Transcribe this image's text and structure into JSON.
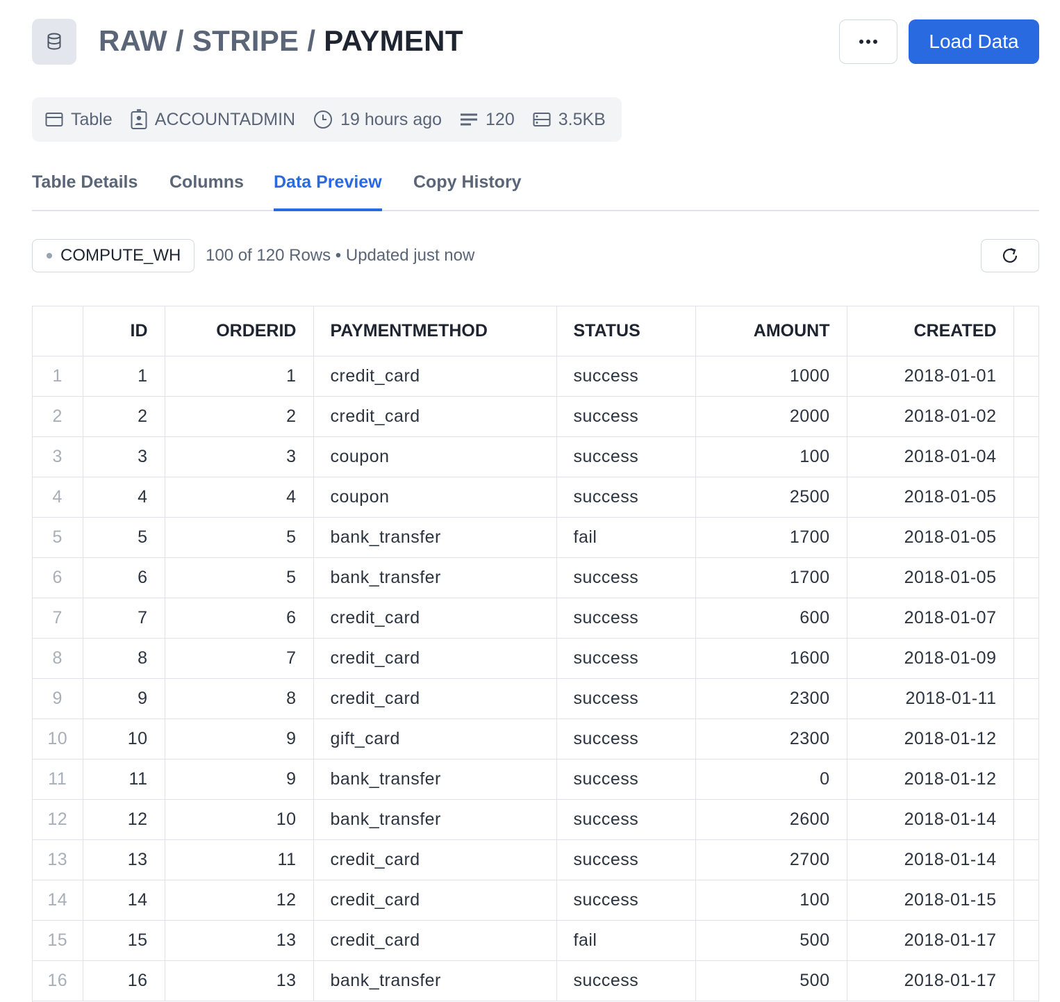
{
  "header": {
    "crumb_1": "RAW",
    "crumb_2": "STRIPE",
    "current": "PAYMENT",
    "separator": "/",
    "load_label": "Load Data"
  },
  "meta": {
    "type": "Table",
    "owner": "ACCOUNTADMIN",
    "updated": "19 hours ago",
    "rows": "120",
    "size": "3.5KB"
  },
  "tabs": [
    {
      "label": "Table Details"
    },
    {
      "label": "Columns"
    },
    {
      "label": "Data Preview"
    },
    {
      "label": "Copy History"
    }
  ],
  "toolbar": {
    "warehouse": "COMPUTE_WH",
    "row_info": "100 of 120 Rows • Updated just now"
  },
  "table": {
    "columns": [
      "ID",
      "ORDERID",
      "PAYMENTMETHOD",
      "STATUS",
      "AMOUNT",
      "CREATED"
    ],
    "rows": [
      {
        "n": "1",
        "id": "1",
        "orderid": "1",
        "method": "credit_card",
        "status": "success",
        "amount": "1000",
        "created": "2018-01-01"
      },
      {
        "n": "2",
        "id": "2",
        "orderid": "2",
        "method": "credit_card",
        "status": "success",
        "amount": "2000",
        "created": "2018-01-02"
      },
      {
        "n": "3",
        "id": "3",
        "orderid": "3",
        "method": "coupon",
        "status": "success",
        "amount": "100",
        "created": "2018-01-04"
      },
      {
        "n": "4",
        "id": "4",
        "orderid": "4",
        "method": "coupon",
        "status": "success",
        "amount": "2500",
        "created": "2018-01-05"
      },
      {
        "n": "5",
        "id": "5",
        "orderid": "5",
        "method": "bank_transfer",
        "status": "fail",
        "amount": "1700",
        "created": "2018-01-05"
      },
      {
        "n": "6",
        "id": "6",
        "orderid": "5",
        "method": "bank_transfer",
        "status": "success",
        "amount": "1700",
        "created": "2018-01-05"
      },
      {
        "n": "7",
        "id": "7",
        "orderid": "6",
        "method": "credit_card",
        "status": "success",
        "amount": "600",
        "created": "2018-01-07"
      },
      {
        "n": "8",
        "id": "8",
        "orderid": "7",
        "method": "credit_card",
        "status": "success",
        "amount": "1600",
        "created": "2018-01-09"
      },
      {
        "n": "9",
        "id": "9",
        "orderid": "8",
        "method": "credit_card",
        "status": "success",
        "amount": "2300",
        "created": "2018-01-11"
      },
      {
        "n": "10",
        "id": "10",
        "orderid": "9",
        "method": "gift_card",
        "status": "success",
        "amount": "2300",
        "created": "2018-01-12"
      },
      {
        "n": "11",
        "id": "11",
        "orderid": "9",
        "method": "bank_transfer",
        "status": "success",
        "amount": "0",
        "created": "2018-01-12"
      },
      {
        "n": "12",
        "id": "12",
        "orderid": "10",
        "method": "bank_transfer",
        "status": "success",
        "amount": "2600",
        "created": "2018-01-14"
      },
      {
        "n": "13",
        "id": "13",
        "orderid": "11",
        "method": "credit_card",
        "status": "success",
        "amount": "2700",
        "created": "2018-01-14"
      },
      {
        "n": "14",
        "id": "14",
        "orderid": "12",
        "method": "credit_card",
        "status": "success",
        "amount": "100",
        "created": "2018-01-15"
      },
      {
        "n": "15",
        "id": "15",
        "orderid": "13",
        "method": "credit_card",
        "status": "fail",
        "amount": "500",
        "created": "2018-01-17"
      },
      {
        "n": "16",
        "id": "16",
        "orderid": "13",
        "method": "bank_transfer",
        "status": "success",
        "amount": "500",
        "created": "2018-01-17"
      }
    ]
  },
  "colors": {
    "accent": "#2a6ae0",
    "muted_text": "#5a6577",
    "border": "#dfe3e9"
  },
  "icons": {
    "tile": "database-icon",
    "more": "more-icon",
    "type": "table-icon",
    "owner": "user-badge-icon",
    "clock": "clock-icon",
    "rows": "rows-icon",
    "size": "storage-icon",
    "refresh": "refresh-icon"
  }
}
